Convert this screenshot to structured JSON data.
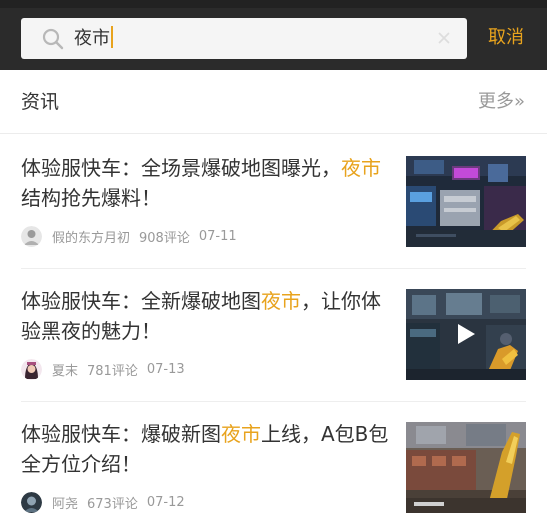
{
  "search": {
    "query": "夜市",
    "cancel_label": "取消"
  },
  "section": {
    "title": "资讯",
    "more_label": "更多»"
  },
  "colors": {
    "accent": "#e8a31d",
    "topbar": "#2b2b2b",
    "muted": "#999999"
  },
  "articles": [
    {
      "title_before": "体验服快车：全场景爆破地图曝光，",
      "title_highlight": "夜市",
      "title_after": "结构抢先爆料！",
      "author": "假的东方月初",
      "comments": "908评论",
      "date": "07-11",
      "thumbnail_icon": "game-scene-thumbnail",
      "has_video": false
    },
    {
      "title_before": "体验服快车：全新爆破地图",
      "title_highlight": "夜市",
      "title_after": "，让你体验黑夜的魅力！",
      "author": "夏末",
      "comments": "781评论",
      "date": "07-13",
      "thumbnail_icon": "video-thumbnail",
      "has_video": true
    },
    {
      "title_before": "体验服快车：爆破新图",
      "title_highlight": "夜市",
      "title_after": "上线，A包B包全方位介绍！",
      "author": "阿尧",
      "comments": "673评论",
      "date": "07-12",
      "thumbnail_icon": "game-scene-thumbnail",
      "has_video": false
    }
  ]
}
